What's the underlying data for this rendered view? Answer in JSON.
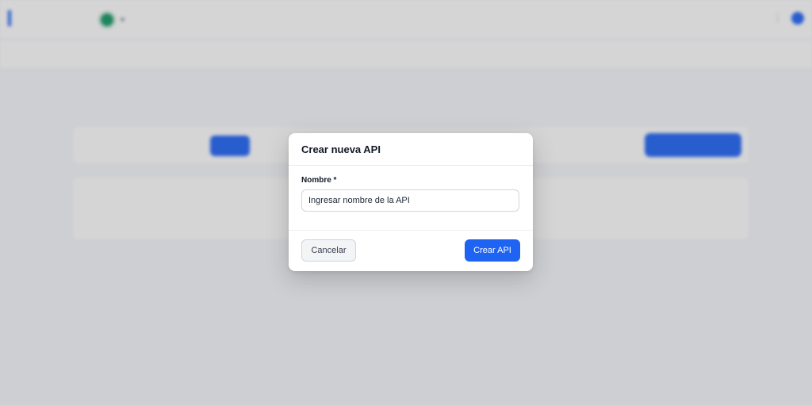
{
  "modal": {
    "title": "Crear nueva API",
    "field_label": "Nombre *",
    "input_placeholder": "Ingresar nombre de la API",
    "input_value": "",
    "cancel_label": "Cancelar",
    "create_label": "Crear API"
  },
  "colors": {
    "accent": "#1f63f2",
    "overlay": "rgba(20,22,28,0.18)"
  }
}
